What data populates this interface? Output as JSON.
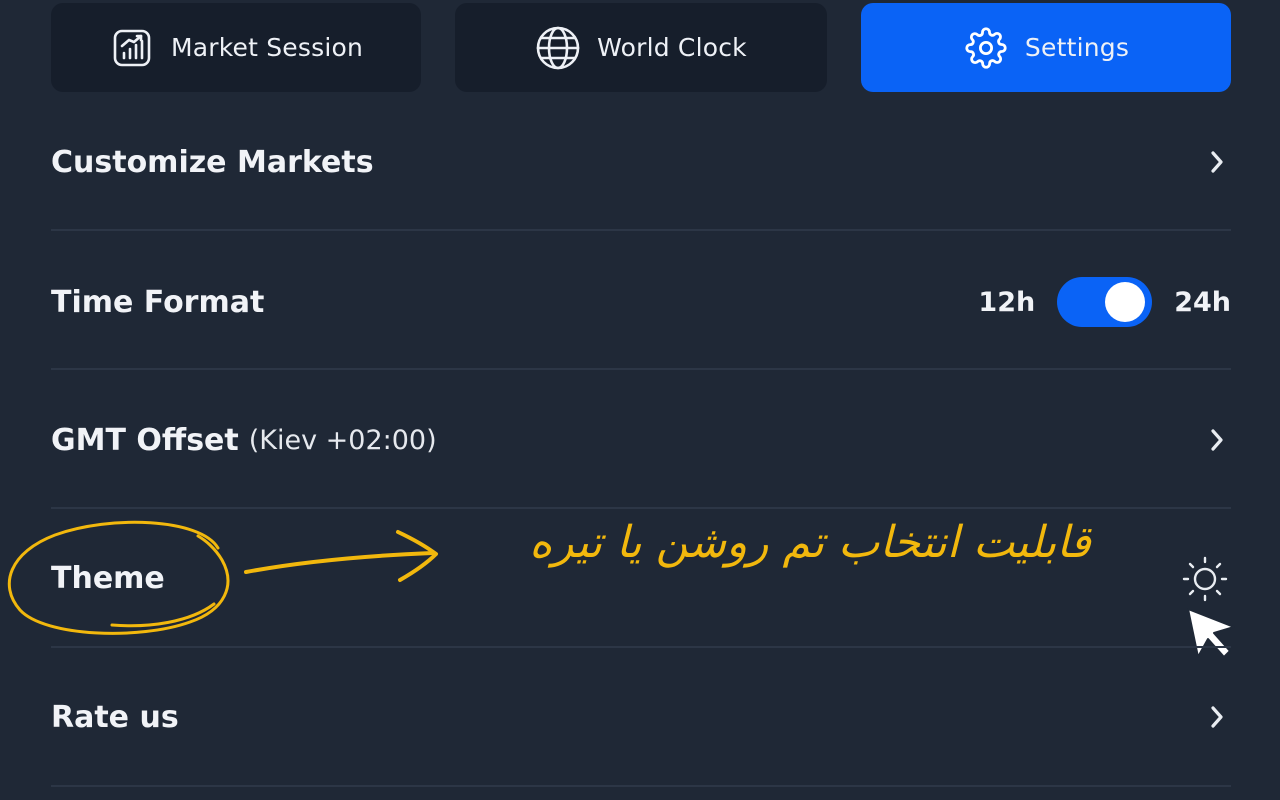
{
  "tabs": [
    {
      "label": "Market Session",
      "icon": "chart-growth-icon",
      "active": false
    },
    {
      "label": "World Clock",
      "icon": "globe-icon",
      "active": false
    },
    {
      "label": "Settings",
      "icon": "gear-icon",
      "active": true
    }
  ],
  "settings": {
    "customize_markets": {
      "label": "Customize Markets"
    },
    "time_format": {
      "label": "Time Format",
      "left_option": "12h",
      "right_option": "24h",
      "selected": "24h"
    },
    "gmt_offset": {
      "label": "GMT Offset",
      "value": "(Kiev +02:00)"
    },
    "theme": {
      "label": "Theme",
      "icon": "sun-icon"
    },
    "rate_us": {
      "label": "Rate us"
    }
  },
  "annotation": {
    "text": "قابلیت انتخاب تم روشن یا تیره"
  },
  "colors": {
    "background": "#1f2836",
    "tab_background": "#161e2b",
    "accent": "#0a63f6",
    "annotation": "#f2b80d"
  }
}
